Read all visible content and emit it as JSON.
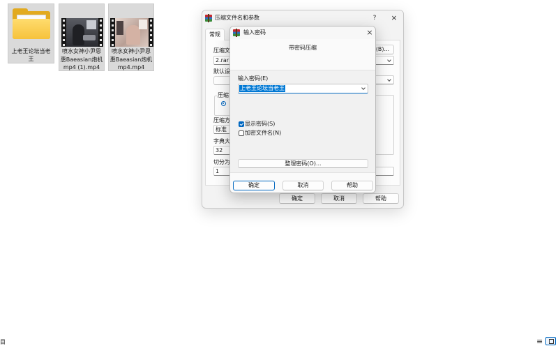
{
  "explorer": {
    "files": [
      {
        "icon": "folder-icon",
        "selected": true,
        "label_lines": [
          "上老王论坛当老",
          "王"
        ]
      },
      {
        "icon": "video-thumbnail",
        "selected": true,
        "label_lines": [
          "喷水女神小尹恩",
          "惠Baeasian炮机",
          "mp4 (1).mp4"
        ]
      },
      {
        "icon": "video-thumbnail",
        "selected": true,
        "label_lines": [
          "喷水女神小尹恩",
          "惠Baeasian炮机",
          "mp4.mp4"
        ]
      }
    ],
    "status_text": "目",
    "view_buttons": {
      "details": {
        "icon": "details-view-icon",
        "glyph": "≡"
      },
      "tiles": {
        "icon": "tiles-view-icon",
        "active": true
      }
    }
  },
  "archive_dialog": {
    "title": "压缩文件名和参数",
    "help_glyph": "?",
    "close_glyph": "×",
    "tabs": [
      {
        "label": "常规",
        "active": true
      }
    ],
    "archive_name": {
      "label": "压缩文",
      "value": "2.rar"
    },
    "browse_button": "(B)...",
    "default_profile_label": "默认设",
    "format_group_label": "压缩",
    "method": {
      "label": "压缩方",
      "value": "标准"
    },
    "dictionary": {
      "label": "字典大",
      "value": "32"
    },
    "split": {
      "label": "切分为",
      "value": "1"
    },
    "buttons": {
      "ok": "确定",
      "cancel": "取消",
      "help": "帮助"
    }
  },
  "password_dialog": {
    "title": "输入密码",
    "close_glyph": "×",
    "heading": "带密码压缩",
    "password": {
      "label": "输入密码(E)",
      "value": "上老王论坛当老王"
    },
    "show_password": {
      "label": "显示密码(S)",
      "checked": true
    },
    "encrypt_filenames": {
      "label": "加密文件名(N)",
      "checked": false
    },
    "organize_button": "整理密码(O)...",
    "buttons": {
      "ok": "确定",
      "cancel": "取消",
      "help": "帮助"
    }
  },
  "colors": {
    "accent": "#0067c0",
    "text_selection": "#0078d4",
    "item_selected": "#dadada",
    "dialog_bg": "#f3f3f3"
  }
}
